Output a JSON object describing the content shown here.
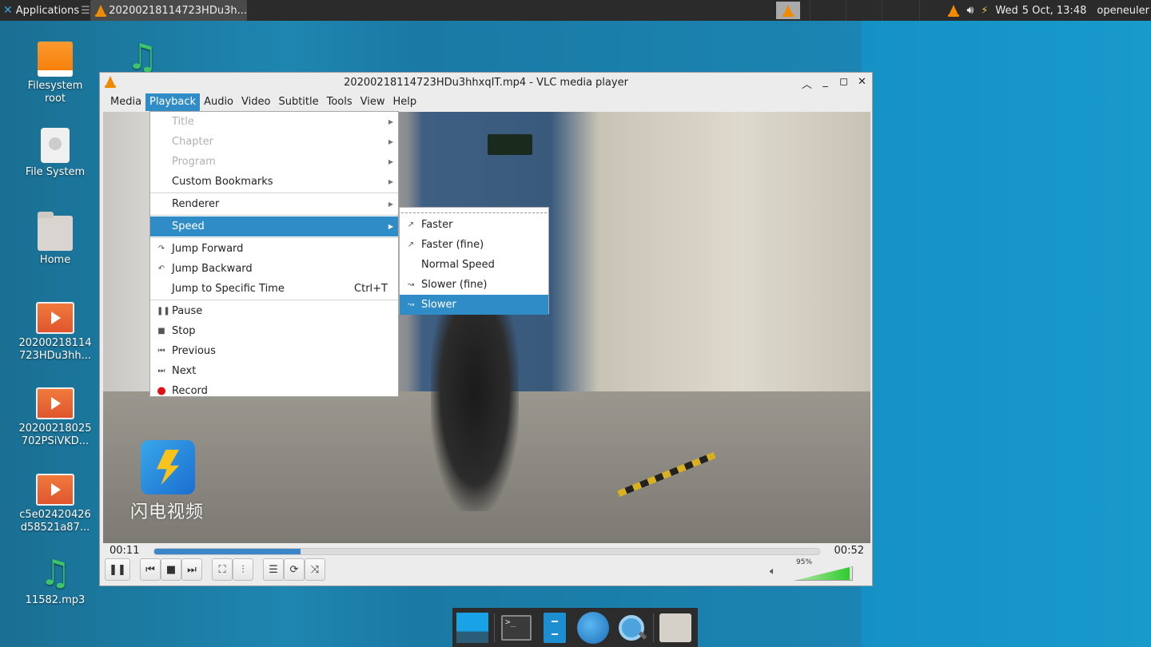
{
  "topbar": {
    "applications_label": "Applications",
    "task_title": "20200218114723HDu3h...",
    "date": "Wed",
    "day_month": "5 Oct, 13:48",
    "user": "openeuler",
    "icons": [
      "vlc-tray-icon",
      "speaker-icon",
      "power-icon"
    ]
  },
  "desktop": {
    "icons": [
      {
        "label": "Filesystem\nroot",
        "line1": "Filesystem",
        "line2": "root",
        "icon": "drive-orange-icon"
      },
      {
        "label": "File System",
        "icon": "disk-icon"
      },
      {
        "label": "Home",
        "icon": "home-folder-icon"
      },
      {
        "line1": "20200218114",
        "line2": "723HDu3hh...",
        "icon": "video-file-icon"
      },
      {
        "line1": "20200218025",
        "line2": "702PSiVKD...",
        "icon": "video-file-icon"
      },
      {
        "line1": "c5e02420426",
        "line2": "d58521a87...",
        "icon": "video-file-icon"
      },
      {
        "line1": "11582.mp3",
        "icon": "music-file-icon"
      }
    ]
  },
  "window": {
    "title": "20200218114723HDu3hhxqIT.mp4 - VLC media player",
    "menu": [
      "Media",
      "Playback",
      "Audio",
      "Video",
      "Subtitle",
      "Tools",
      "View",
      "Help"
    ],
    "active_menu": "Playback",
    "video_watermark": "闪电视频",
    "current_time": "00:11",
    "total_time": "00:52",
    "progress_fraction": 0.22,
    "volume_label": "95%",
    "volume_fraction": 0.95
  },
  "playback_menu": {
    "items": [
      {
        "label": "Title",
        "disabled": true,
        "submenu": true
      },
      {
        "label": "Chapter",
        "disabled": true,
        "submenu": true
      },
      {
        "label": "Program",
        "disabled": true,
        "submenu": true
      },
      {
        "label": "Custom Bookmarks",
        "submenu": true
      },
      {
        "label": "Renderer",
        "submenu": true
      },
      {
        "label": "Speed",
        "submenu": true,
        "highlighted": true
      },
      {
        "label": "Jump Forward",
        "icon": "jump-forward-icon"
      },
      {
        "label": "Jump Backward",
        "icon": "jump-backward-icon"
      },
      {
        "label": "Jump to Specific Time",
        "shortcut": "Ctrl+T"
      },
      {
        "label": "Pause",
        "icon": "pause-icon"
      },
      {
        "label": "Stop",
        "icon": "stop-icon"
      },
      {
        "label": "Previous",
        "icon": "previous-icon"
      },
      {
        "label": "Next",
        "icon": "next-icon"
      },
      {
        "label": "Record",
        "icon": "record-icon"
      }
    ]
  },
  "speed_menu": {
    "items": [
      {
        "label": "Faster",
        "icon": "faster-icon"
      },
      {
        "label": "Faster (fine)",
        "icon": "faster-fine-icon"
      },
      {
        "label": "Normal Speed"
      },
      {
        "label": "Slower (fine)",
        "icon": "slower-fine-icon"
      },
      {
        "label": "Slower",
        "icon": "slower-icon",
        "highlighted": true
      }
    ]
  },
  "colors": {
    "accent": "#308cc6",
    "desktop_bg": "#1a84b2",
    "vlc_orange": "#f08a00",
    "record_red": "#e01010"
  }
}
